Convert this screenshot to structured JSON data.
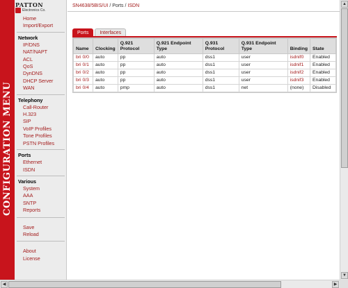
{
  "side_banner": "CONFIGURATION MENU",
  "logo": {
    "name": "PATTON",
    "tagline": "Electronics Co."
  },
  "sidebar": {
    "top": [
      {
        "label": "Home"
      },
      {
        "label": "Import/Export"
      }
    ],
    "sections": [
      {
        "title": "Network",
        "items": [
          "IP/DNS",
          "NAT/NAPT",
          "ACL",
          "QoS",
          "DynDNS",
          "DHCP Server",
          "WAN"
        ]
      },
      {
        "title": "Telephony",
        "items": [
          "Call-Router",
          "H.323",
          "SIP",
          "VoIP Profiles",
          "Tone Profiles",
          "PSTN Profiles"
        ]
      },
      {
        "title": "Ports",
        "items": [
          "Ethernet",
          "ISDN"
        ]
      },
      {
        "title": "Various",
        "items": [
          "System",
          "AAA",
          "SNTP",
          "Reports"
        ]
      }
    ],
    "actions": [
      "Save",
      "Reload"
    ],
    "bottom": [
      "About",
      "License"
    ]
  },
  "breadcrumb": {
    "device": "SN4638/5BIS/UI",
    "sep1": " / ",
    "section": "Ports",
    "sep2": " / ",
    "page": "ISDN"
  },
  "tabs": [
    {
      "label": "Ports",
      "active": true
    },
    {
      "label": "Interfaces",
      "active": false
    }
  ],
  "table": {
    "headers": [
      "Name",
      "Clocking",
      "Q.921 Protocol",
      "Q.921 Endpoint Type",
      "Q.931 Protocol",
      "Q.931 Endpoint Type",
      "Binding",
      "State"
    ],
    "rows": [
      [
        "bri 0/0",
        "auto",
        "pp",
        "auto",
        "dss1",
        "user",
        "isdnif0",
        "Enabled"
      ],
      [
        "bri 0/1",
        "auto",
        "pp",
        "auto",
        "dss1",
        "user",
        "isdnif1",
        "Enabled"
      ],
      [
        "bri 0/2",
        "auto",
        "pp",
        "auto",
        "dss1",
        "user",
        "isdnif2",
        "Enabled"
      ],
      [
        "bri 0/3",
        "auto",
        "pp",
        "auto",
        "dss1",
        "user",
        "isdnif3",
        "Enabled"
      ],
      [
        "bri 0/4",
        "auto",
        "pmp",
        "auto",
        "dss1",
        "net",
        "(none)",
        "Disabled"
      ]
    ]
  },
  "colors": {
    "brand_red": "#c8141c",
    "link": "#a31b1b",
    "sidebar_bg": "#ececec"
  },
  "icons": {
    "scroll_up": "arrow-up-icon",
    "scroll_down": "arrow-down-icon",
    "scroll_left": "arrow-left-icon",
    "scroll_right": "arrow-right-icon"
  }
}
